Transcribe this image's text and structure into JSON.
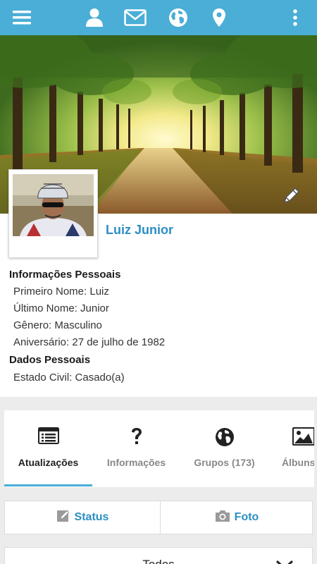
{
  "topbar": {
    "icons": [
      "menu-icon",
      "user-icon",
      "mail-icon",
      "globe-icon",
      "location-pin-icon",
      "more-vertical-icon"
    ],
    "color": "#4aaed6"
  },
  "profile": {
    "name": "Luiz Junior"
  },
  "personal_info": {
    "heading": "Informações Pessoais",
    "items": [
      "Primeiro Nome: Luiz",
      "Último Nome: Junior",
      "Gênero: Masculino",
      "Aniversário: 27 de julho de 1982"
    ]
  },
  "personal_data": {
    "heading": "Dados Pessoais",
    "items": [
      "Estado Civil: Casado(a)"
    ]
  },
  "tabs": [
    {
      "label": "Atualizações",
      "icon": "list-icon",
      "active": true
    },
    {
      "label": "Informações",
      "icon": "question-icon",
      "active": false
    },
    {
      "label": "Grupos (173)",
      "icon": "globe-icon",
      "active": false
    },
    {
      "label": "Álbuns",
      "icon": "image-icon",
      "active": false
    }
  ],
  "post_actions": {
    "status_label": "Status",
    "photo_label": "Foto"
  },
  "filter": {
    "label": "Todos"
  },
  "colors": {
    "accent": "#4aaed6",
    "link": "#2c8fc3"
  }
}
